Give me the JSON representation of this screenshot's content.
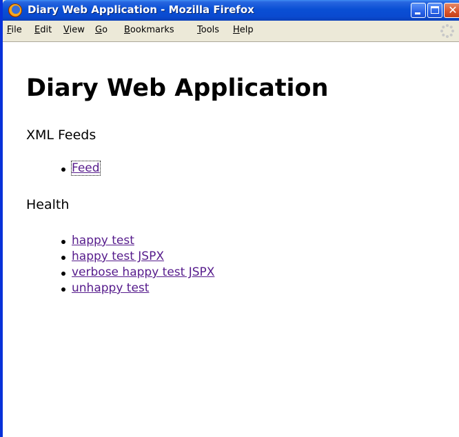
{
  "window": {
    "title": "Diary Web Application - Mozilla Firefox"
  },
  "menubar": {
    "items": [
      {
        "label": "File",
        "access": "F",
        "rest": "ile"
      },
      {
        "label": "Edit",
        "access": "E",
        "rest": "dit"
      },
      {
        "label": "View",
        "access": "V",
        "rest": "iew"
      },
      {
        "label": "Go",
        "access": "G",
        "rest": "o"
      },
      {
        "label": "Bookmarks",
        "access": "B",
        "rest": "ookmarks"
      },
      {
        "label": "Tools",
        "access": "T",
        "rest": "ools"
      },
      {
        "label": "Help",
        "access": "H",
        "rest": "elp"
      }
    ]
  },
  "page": {
    "heading": "Diary Web Application",
    "sections": [
      {
        "title": "XML Feeds",
        "links": [
          "Feed"
        ]
      },
      {
        "title": "Health",
        "links": [
          "happy test",
          "happy test JSPX",
          "verbose happy test JSPX",
          "unhappy test"
        ]
      }
    ]
  },
  "colors": {
    "titlebar": "#0a4fd4",
    "link_visited": "#551a8b",
    "chrome": "#ece9d8"
  }
}
